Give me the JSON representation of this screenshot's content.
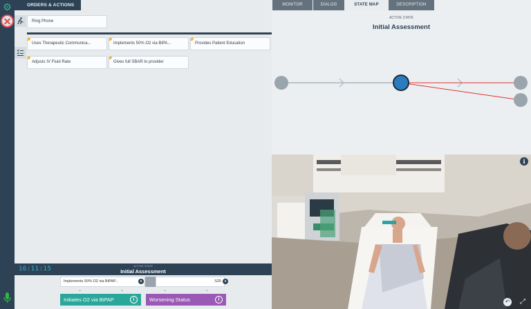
{
  "rail": {
    "settings_icon": "gear-icon",
    "stop_icon": "stop-icon",
    "mic_icon": "microphone-icon"
  },
  "orders": {
    "tab_label": "ORDERS & ACTIONS",
    "ring_phone": "Ring Phone",
    "actions": [
      {
        "label": "Uses Therapeutic Communica..."
      },
      {
        "label": "Implements 50% O2 via BiPA..."
      },
      {
        "label": "Provides Patient Education"
      },
      {
        "label": "Adjusts IV Fluid Rate"
      },
      {
        "label": "Gives full SBAR to provider"
      }
    ]
  },
  "status": {
    "timer": "16:11:15",
    "active_label": "ACTIVE STATE",
    "active_title": "Initial Assessment",
    "segment_left": "Implements 50% O2 via BiPAP...",
    "segment_left_marker": "0",
    "segment_right": "S25",
    "segment_right_marker": "0",
    "btn_o2": "Initiates O2 via BiPAP",
    "btn_worsening": "Worsening Status"
  },
  "right_tabs": {
    "monitor": "MONITOR",
    "dialog": "DIALOG",
    "state_map": "STATE MAP",
    "description": "DESCRIPTION"
  },
  "state_map": {
    "active_label": "ACTIVE STATE",
    "active_title": "Initial Assessment"
  },
  "colors": {
    "rail": "#2d4355",
    "teal": "#2aa79b",
    "purple": "#9b59b6",
    "active_node": "#2b7bbf",
    "red_link": "#e03030"
  }
}
